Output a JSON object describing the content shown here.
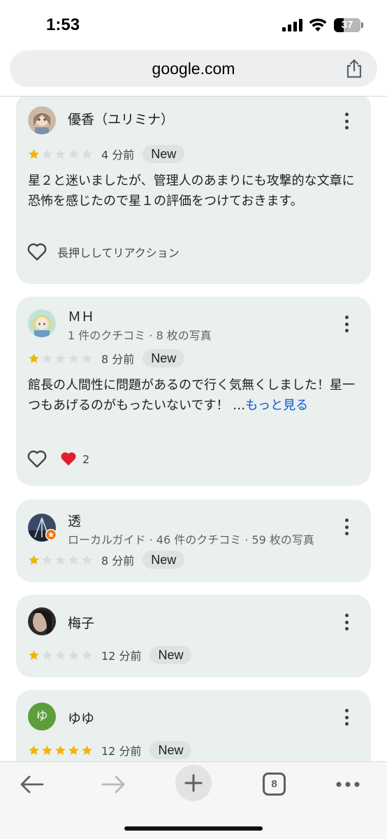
{
  "status_bar": {
    "time": "1:53",
    "battery": "37",
    "battery_level": 0.37
  },
  "browser": {
    "url": "google.com",
    "icons": {
      "share": "share-icon",
      "back": "arrow-left-icon",
      "forward": "arrow-right-icon",
      "new_tab": "plus-icon",
      "tabs": "tabs-icon",
      "menu": "more-horizontal-icon"
    }
  },
  "reviews": [
    {
      "name": "優香（ユリミナ）",
      "meta": "",
      "rating": 1,
      "time": "4 分前",
      "badge": "New",
      "text": "星２と迷いましたが、管理人のあまりにも攻撃的な文章に恐怖を感じたので星１の評価をつけておきます。",
      "reaction_hint": "長押ししてリアクション"
    },
    {
      "name": "ＭＨ",
      "meta": "1 件のクチコミ · 8 枚の写真",
      "rating": 1,
      "time": "8 分前",
      "badge": "New",
      "text": "館長の人間性に問題があるので行く気無くしました！星一つもあげるのがもったいないです！ …",
      "more": "もっと見る",
      "reaction_count": "2"
    },
    {
      "name": "透",
      "meta": "ローカルガイド · 46 件のクチコミ · 59 枚の写真",
      "rating": 1,
      "time": "8 分前",
      "badge": "New"
    },
    {
      "name": "梅子",
      "meta": "",
      "rating": 1,
      "time": "12 分前",
      "badge": "New"
    },
    {
      "name": "ゆゆ",
      "avatar_letter": "ゆ",
      "meta": "",
      "rating": 5,
      "time": "12 分前",
      "badge": "New"
    }
  ],
  "bottom_bar": {
    "tab_count": "8"
  },
  "colors": {
    "star_filled": "#f4b400",
    "star_empty": "#dadce0",
    "card_bg": "#e9f0ee",
    "link": "#0b57d0",
    "avatar_green": "#5d9e3a"
  }
}
